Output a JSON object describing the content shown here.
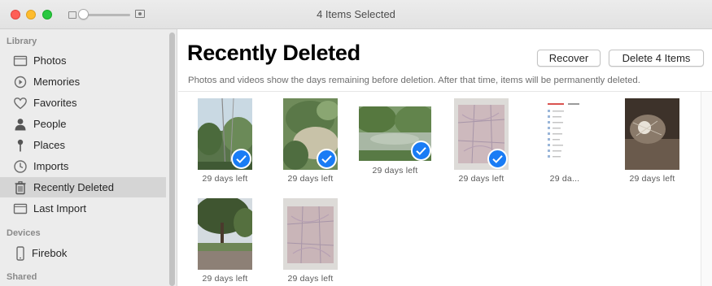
{
  "window": {
    "title": "4 Items Selected"
  },
  "sidebar": {
    "sections": [
      {
        "header": "Library"
      },
      {
        "header": "Devices"
      },
      {
        "header": "Shared"
      }
    ],
    "items": [
      {
        "label": "Photos",
        "icon": "photos-icon"
      },
      {
        "label": "Memories",
        "icon": "memories-icon"
      },
      {
        "label": "Favorites",
        "icon": "heart-icon"
      },
      {
        "label": "People",
        "icon": "person-icon"
      },
      {
        "label": "Places",
        "icon": "pin-icon"
      },
      {
        "label": "Imports",
        "icon": "clock-icon"
      },
      {
        "label": "Recently Deleted",
        "icon": "trash-icon",
        "selected": true
      },
      {
        "label": "Last Import",
        "icon": "photos-icon"
      }
    ],
    "devices": [
      {
        "label": "Firebok",
        "icon": "phone-icon"
      }
    ]
  },
  "main": {
    "title": "Recently Deleted",
    "recover_label": "Recover",
    "delete_label": "Delete 4 Items",
    "info": "Photos and videos show the days remaining before deletion. After that time, items will be permanently deleted.",
    "accent": "#1a7cf5"
  },
  "photos": [
    {
      "caption": "29 days left",
      "selected": true,
      "subject": "trees-power-lines"
    },
    {
      "caption": "29 days left",
      "selected": true,
      "subject": "leafy-garden"
    },
    {
      "caption": "29 days left",
      "selected": true,
      "subject": "river-trees"
    },
    {
      "caption": "29 days left",
      "selected": true,
      "subject": "paper-map"
    },
    {
      "caption": "29 da...",
      "selected": false,
      "subject": "phone-screenshot"
    },
    {
      "caption": "29 days left",
      "selected": false,
      "subject": "chandelier"
    },
    {
      "caption": "29 days left",
      "selected": false,
      "subject": "tree-road"
    },
    {
      "caption": "29 days left",
      "selected": false,
      "subject": "paper-map"
    }
  ]
}
